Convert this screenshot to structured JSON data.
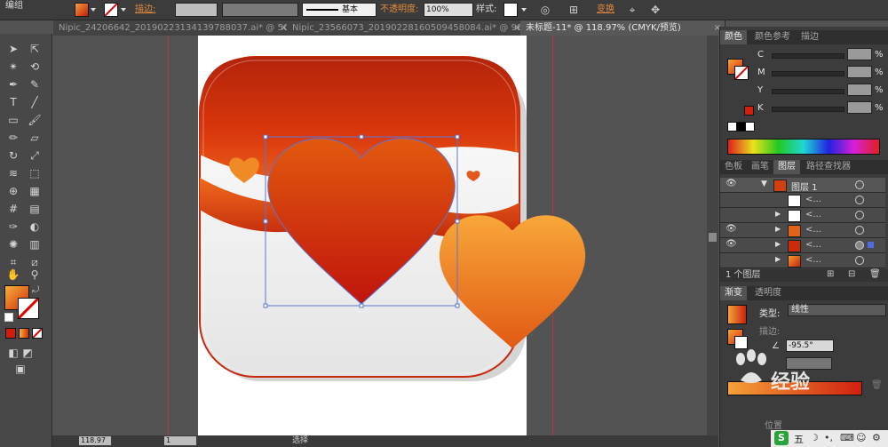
{
  "control_bar": {
    "group_label": "编组",
    "stroke_label": "描边:",
    "stroke_profile": "基本",
    "opacity_label": "不透明度:",
    "opacity_value": "100%",
    "style_label": "样式:",
    "transform_label": "变换"
  },
  "tabs": [
    {
      "label": "Nipic_24206642_20190223134139788037.ai* @ 50...",
      "active": false
    },
    {
      "label": "Nipic_23566073_20190228160509458084.ai* @ 98...",
      "active": false
    },
    {
      "label": "未标题-11* @ 118.97% (CMYK/预览)",
      "active": true
    }
  ],
  "status_bar": {
    "zoom": "118.97",
    "page": "1",
    "mode": "选择"
  },
  "color_panel": {
    "tabs": [
      "颜色",
      "颜色参考",
      "描边"
    ],
    "channels": [
      {
        "name": "C",
        "unit": "%"
      },
      {
        "name": "M",
        "unit": "%"
      },
      {
        "name": "Y",
        "unit": "%"
      },
      {
        "name": "K",
        "unit": "%"
      }
    ]
  },
  "layers_panel": {
    "tabs": [
      "色板",
      "画笔",
      "图层",
      "路径查找器"
    ],
    "layer_name": "图层 1",
    "sublayers": [
      "<...",
      "<...",
      "<...",
      "<...",
      "<..."
    ],
    "footer_count": "1 个图层"
  },
  "gradient_panel": {
    "tabs": [
      "渐变",
      "透明度"
    ],
    "type_label": "类型:",
    "type_value": "线性",
    "stroke_label": "描边:",
    "angle_value": "-95.5°",
    "location_label": "位置"
  },
  "watermark": {
    "text": "经验"
  },
  "taskbar": {
    "ime_label": "五"
  },
  "colors": {
    "accent_orange": "#e0530f",
    "heart_red": "#c4180c",
    "heart_orange": "#f3a43e",
    "guide_red": "#b7373b"
  }
}
